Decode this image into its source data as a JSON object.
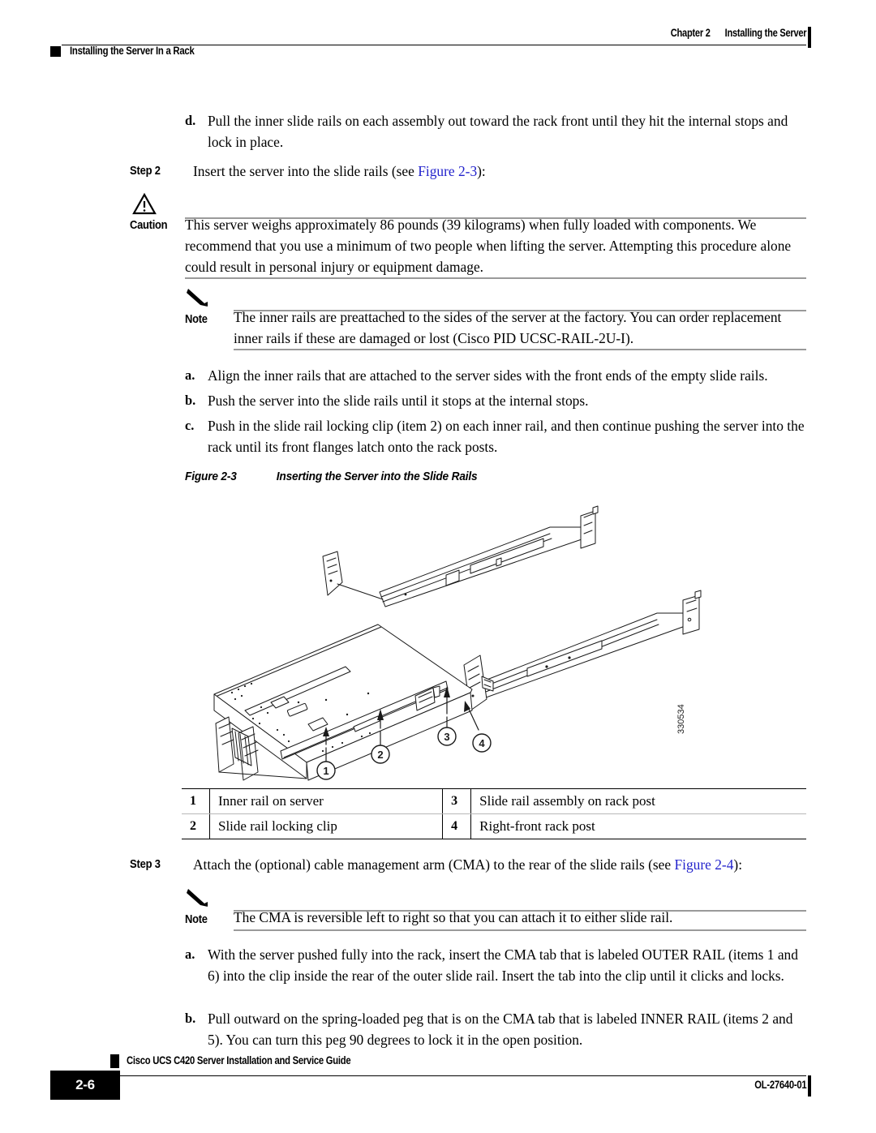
{
  "header": {
    "chapter": "Chapter 2",
    "chapter_title": "Installing the Server",
    "section": "Installing the Server In a Rack"
  },
  "content": {
    "item_d": {
      "marker": "d.",
      "text": "Pull the inner slide rails on each assembly out toward the rack front until they hit the internal stops and lock in place."
    },
    "step2": {
      "label": "Step 2",
      "text_before": "Insert the server into the slide rails (see ",
      "link": "Figure 2-3",
      "text_after": "):"
    },
    "caution": {
      "label": "Caution",
      "icon": "warning-triangle-icon",
      "text": "This server weighs approximately 86 pounds (39 kilograms) when fully loaded with components. We recommend that you use a minimum of two people when lifting the server. Attempting this procedure alone could result in personal injury or equipment damage."
    },
    "note1": {
      "label": "Note",
      "icon": "pencil-icon",
      "text": "The inner rails are preattached to the sides of the server at the factory. You can order replacement inner rails if these are damaged or lost (Cisco PID UCSC-RAIL-2U-I)."
    },
    "list_abc": [
      {
        "marker": "a.",
        "text": "Align the inner rails that are attached to the server sides with the front ends of the empty slide rails."
      },
      {
        "marker": "b.",
        "text": "Push the server into the slide rails until it stops at the internal stops."
      },
      {
        "marker": "c.",
        "text": "Push in the slide rail locking clip (item 2) on each inner rail, and then continue pushing the server into the rack until its front flanges latch onto the rack posts."
      }
    ],
    "figure": {
      "number": "Figure 2-3",
      "title": "Inserting the Server into the Slide Rails",
      "image_id": "330534",
      "callouts": [
        "1",
        "2",
        "3",
        "4"
      ],
      "legend": [
        {
          "n": "1",
          "text": "Inner rail on server"
        },
        {
          "n": "3",
          "text": "Slide rail assembly on rack post"
        },
        {
          "n": "2",
          "text": "Slide rail locking clip"
        },
        {
          "n": "4",
          "text": "Right-front rack post"
        }
      ]
    },
    "step3": {
      "label": "Step 3",
      "text_before": "Attach the (optional) cable management arm (CMA) to the rear of the slide rails (see ",
      "link": "Figure 2-4",
      "text_after": "):"
    },
    "note2": {
      "label": "Note",
      "icon": "pencil-icon",
      "text": "The CMA is reversible left to right so that you can attach it to either slide rail."
    },
    "list_ab2": [
      {
        "marker": "a.",
        "text": "With the server pushed fully into the rack, insert the CMA tab that is labeled OUTER RAIL (items 1 and 6) into the clip inside the rear of the outer slide rail. Insert the tab into the clip until it clicks and locks."
      },
      {
        "marker": "b.",
        "text": "Pull outward on the spring-loaded peg that is on the CMA tab that is labeled INNER RAIL (items 2 and 5). You can turn this peg 90 degrees to lock it in the open position."
      }
    ]
  },
  "footer": {
    "page_number": "2-6",
    "guide_title": "Cisco UCS C420 Server Installation and Service Guide",
    "doc_id": "OL-27640-01"
  },
  "colors": {
    "link": "#2222cc",
    "rule": "#9a9a9a",
    "black": "#000000"
  }
}
